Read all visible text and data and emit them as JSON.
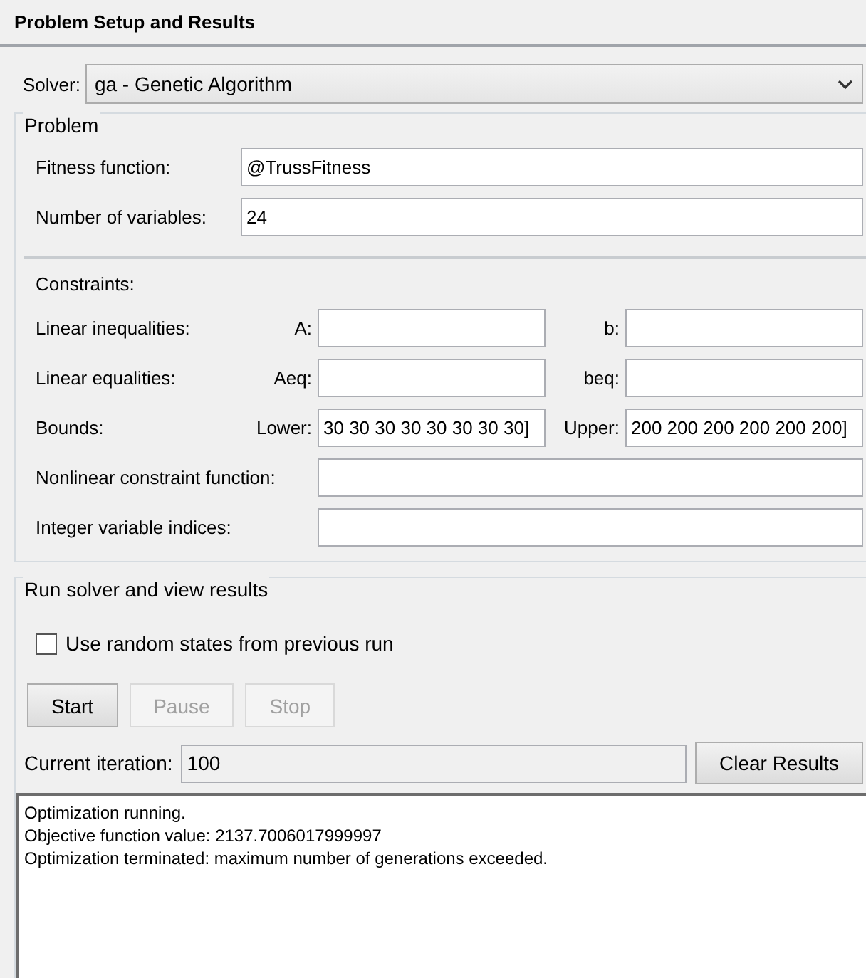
{
  "panel": {
    "title": "Problem Setup and Results"
  },
  "solver": {
    "label": "Solver:",
    "value": "ga - Genetic Algorithm"
  },
  "problem": {
    "title": "Problem",
    "fields": [
      {
        "label": "Fitness function:",
        "value": "@TrussFitness"
      },
      {
        "label": "Number of variables:",
        "value": "24"
      }
    ]
  },
  "constraints": {
    "title": "Constraints:",
    "pairs": [
      {
        "label": "Linear inequalities:",
        "left_label": "A:",
        "right_label": "b:"
      },
      {
        "label": "Linear equalities:",
        "left_label": "Aeq:",
        "right_label": "beq:"
      },
      {
        "label": "Bounds:",
        "left_label": "Lower:",
        "left_value": "30 30 30 30 30 30 30 30]",
        "right_label": "Upper:",
        "right_value": "200 200 200 200 200 200]"
      }
    ],
    "fields": [
      {
        "label": "Nonlinear constraint function:"
      },
      {
        "label": "Integer variable indices:"
      }
    ]
  },
  "run": {
    "title": "Run solver and view results",
    "checkbox": {
      "label": "Use random states from previous run",
      "checked": false
    },
    "buttons": [
      {
        "label": "Start",
        "disabled": false
      },
      {
        "label": "Pause",
        "disabled": true
      },
      {
        "label": "Stop",
        "disabled": true
      }
    ],
    "iteration": {
      "label": "Current iteration:",
      "value": "100"
    },
    "clear_button": "Clear Results",
    "output": [
      "Optimization running.",
      "Objective function value: 2137.7006017999997",
      "Optimization terminated: maximum number of generations exceeded."
    ]
  }
}
